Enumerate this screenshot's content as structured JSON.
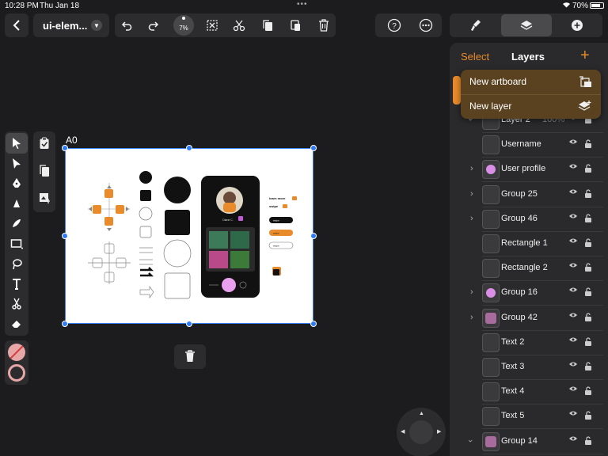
{
  "status_bar": {
    "time": "10:28 PM",
    "date": "Thu Jan 18",
    "battery": "70%"
  },
  "toolbar": {
    "document_title": "ui-elem...",
    "zoom": "7%"
  },
  "canvas": {
    "artboard_label": "A0",
    "mockup": {
      "profile_name": "Diane C.",
      "learn_more": "learn more",
      "swipe_label": "swipe",
      "chip_label": "swipe"
    }
  },
  "layers_panel": {
    "select_label": "Select",
    "title": "Layers",
    "popup_menu": [
      "New artboard",
      "New layer"
    ],
    "rows": [
      {
        "name": "Layer 2",
        "opacity": "100%",
        "expand": "down",
        "thumb": "grey"
      },
      {
        "name": "Username",
        "expand": "",
        "thumb": "grey"
      },
      {
        "name": "User profile",
        "expand": "right",
        "thumb": "pink"
      },
      {
        "name": "Group 25",
        "expand": "right",
        "thumb": "grey"
      },
      {
        "name": "Group 46",
        "expand": "right",
        "thumb": "grey"
      },
      {
        "name": "Rectangle 1",
        "expand": "",
        "thumb": "grey"
      },
      {
        "name": "Rectangle 2",
        "expand": "",
        "thumb": "grey"
      },
      {
        "name": "Group 16",
        "expand": "right",
        "thumb": "pink"
      },
      {
        "name": "Group 42",
        "expand": "right",
        "thumb": "photo"
      },
      {
        "name": "Text 2",
        "expand": "",
        "thumb": "grey"
      },
      {
        "name": "Text 3",
        "expand": "",
        "thumb": "grey"
      },
      {
        "name": "Text 4",
        "expand": "",
        "thumb": "grey"
      },
      {
        "name": "Text 5",
        "expand": "",
        "thumb": "grey"
      },
      {
        "name": "Group 14",
        "expand": "down",
        "thumb": "photo"
      }
    ]
  },
  "colors": {
    "accent": "#e98b2a",
    "selection": "#2f7bf5",
    "panel": "#2a2a2c",
    "popup": "#5a4220"
  }
}
